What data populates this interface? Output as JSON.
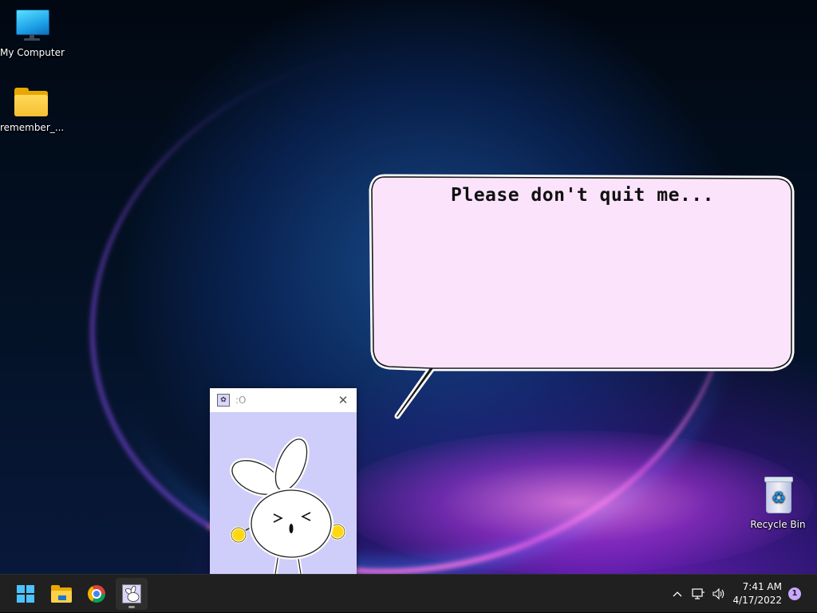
{
  "desktop": {
    "icons": [
      {
        "label": "My Computer",
        "icon": "monitor-icon"
      },
      {
        "label": "remember_...",
        "icon": "folder-icon"
      },
      {
        "label": "Recycle Bin",
        "icon": "recycle-bin-icon"
      }
    ]
  },
  "speech_bubble": {
    "text": "Please don't quit me..."
  },
  "pet_window": {
    "title": ":O",
    "close_glyph": "✕"
  },
  "taskbar": {
    "apps": [
      {
        "name": "Start",
        "icon": "windows-logo-icon"
      },
      {
        "name": "File Explorer",
        "icon": "folder-icon"
      },
      {
        "name": "Google Chrome",
        "icon": "chrome-icon"
      },
      {
        "name": "Desktop Pet",
        "icon": "bunny-app-icon"
      }
    ],
    "tray": {
      "overflow_glyph": "^",
      "clock_time": "7:41 AM",
      "clock_date": "4/17/2022",
      "notification_count": "1"
    }
  },
  "colors": {
    "bubble_fill": "#fbe4fb",
    "pet_background": "#cfcdf9",
    "taskbar": "#202020",
    "accent": "#4cc2ff"
  }
}
